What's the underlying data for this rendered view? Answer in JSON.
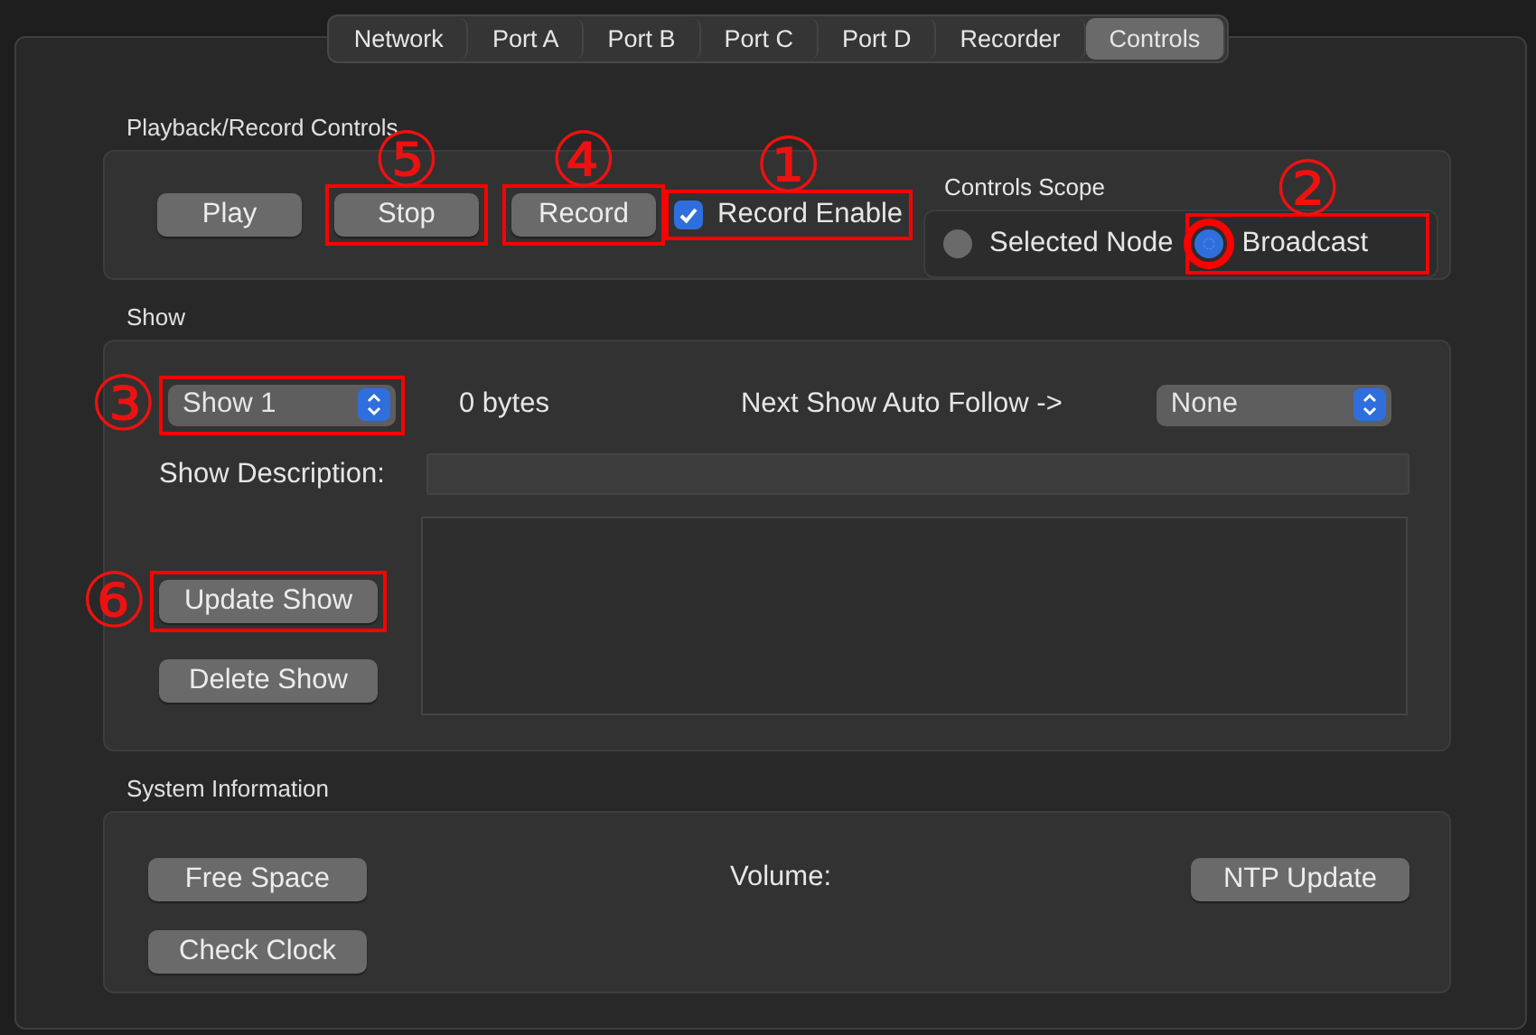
{
  "tabs": [
    {
      "label": "Network",
      "selected": false
    },
    {
      "label": "Port A",
      "selected": false
    },
    {
      "label": "Port B",
      "selected": false
    },
    {
      "label": "Port C",
      "selected": false
    },
    {
      "label": "Port D",
      "selected": false
    },
    {
      "label": "Recorder",
      "selected": false
    },
    {
      "label": "Controls",
      "selected": true
    }
  ],
  "playback": {
    "title": "Playback/Record Controls",
    "buttons": [
      {
        "label": "Play"
      },
      {
        "label": "Stop",
        "highlighted": true,
        "callout": "⑤"
      },
      {
        "label": "Record",
        "highlighted": true,
        "callout": "④"
      }
    ],
    "record_enable": {
      "label": "Record Enable",
      "checked": true,
      "highlighted": true,
      "callout": "①"
    },
    "scope": {
      "title": "Controls Scope",
      "options": [
        {
          "label": "Selected Node",
          "selected": false
        },
        {
          "label": "Broadcast",
          "selected": true,
          "highlighted": true,
          "circled": true,
          "callout": "②"
        }
      ]
    }
  },
  "show": {
    "title": "Show",
    "show_select": {
      "value": "Show 1",
      "highlighted": true,
      "callout": "③"
    },
    "size": "0 bytes",
    "auto_follow_label": "Next Show Auto Follow ->",
    "auto_follow_select": {
      "value": "None"
    },
    "description_label": "Show Description:",
    "buttons": [
      {
        "label": "Update Show",
        "highlighted": true,
        "callout": "⑥"
      },
      {
        "label": "Delete Show"
      }
    ]
  },
  "system": {
    "title": "System Information",
    "buttons": [
      {
        "label": "Free Space"
      },
      {
        "label": "Check Clock"
      }
    ],
    "volume_label": "Volume:",
    "ntp_button": {
      "label": "NTP Update"
    }
  }
}
